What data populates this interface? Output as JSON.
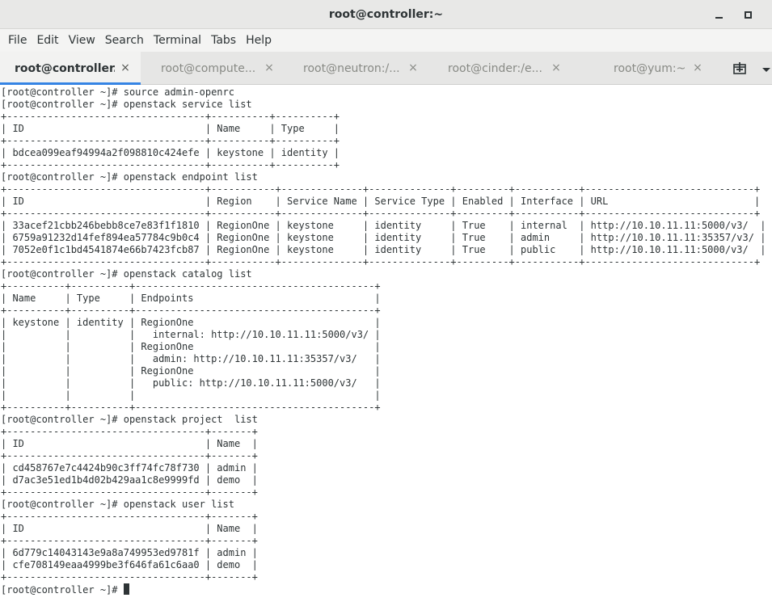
{
  "window": {
    "title": "root@controller:~"
  },
  "menu": {
    "items": [
      "File",
      "Edit",
      "View",
      "Search",
      "Terminal",
      "Tabs",
      "Help"
    ]
  },
  "tabs": [
    {
      "label": "root@controller...",
      "active": true
    },
    {
      "label": "root@compute...",
      "active": false
    },
    {
      "label": "root@neutron:/...",
      "active": false
    },
    {
      "label": "root@cinder:/e...",
      "active": false
    },
    {
      "label": "root@yum:~",
      "active": false
    }
  ],
  "tab_close_glyph": "×",
  "icons": {
    "new_tab": "new-tab-icon",
    "tab_menu": "chevron-down-icon",
    "minimize": "minimize-icon",
    "maximize": "maximize-icon",
    "close": "close-icon"
  },
  "terminal": {
    "lines": [
      "[root@controller ~]# source admin-openrc",
      "[root@controller ~]# openstack service list",
      "+----------------------------------+----------+----------+",
      "| ID                               | Name     | Type     |",
      "+----------------------------------+----------+----------+",
      "| bdcea099eaf94994a2f098810c424efe | keystone | identity |",
      "+----------------------------------+----------+----------+",
      "[root@controller ~]# openstack endpoint list",
      "+----------------------------------+-----------+--------------+--------------+---------+-----------+-----------------------------+",
      "| ID                               | Region    | Service Name | Service Type | Enabled | Interface | URL                         |",
      "+----------------------------------+-----------+--------------+--------------+---------+-----------+-----------------------------+",
      "| 33acef21cbb246bebb8ce7e83f1f1810 | RegionOne | keystone     | identity     | True    | internal  | http://10.10.11.11:5000/v3/  |",
      "| 6759a91232d14fef894ea57784c9b0c4 | RegionOne | keystone     | identity     | True    | admin     | http://10.10.11.11:35357/v3/ |",
      "| 7052e0f1c1bd4541874e66b7423fcb87 | RegionOne | keystone     | identity     | True    | public    | http://10.10.11.11:5000/v3/  |",
      "+----------------------------------+-----------+--------------+--------------+---------+-----------+-----------------------------+",
      "[root@controller ~]# openstack catalog list",
      "+----------+----------+-----------------------------------------+",
      "| Name     | Type     | Endpoints                               |",
      "+----------+----------+-----------------------------------------+",
      "| keystone | identity | RegionOne                               |",
      "|          |          |   internal: http://10.10.11.11:5000/v3/ |",
      "|          |          | RegionOne                               |",
      "|          |          |   admin: http://10.10.11.11:35357/v3/   |",
      "|          |          | RegionOne                               |",
      "|          |          |   public: http://10.10.11.11:5000/v3/   |",
      "|          |          |                                         |",
      "+----------+----------+-----------------------------------------+",
      "[root@controller ~]# openstack project  list",
      "+----------------------------------+-------+",
      "| ID                               | Name  |",
      "+----------------------------------+-------+",
      "| cd458767e7c4424b90c3ff74fc78f730 | admin |",
      "| d7ac3e51ed1b4d02b429aa1c8e9999fd | demo  |",
      "+----------------------------------+-------+",
      "[root@controller ~]# openstack user list",
      "+----------------------------------+-------+",
      "| ID                               | Name  |",
      "+----------------------------------+-------+",
      "| 6d779c14043143e9a8a749953ed9781f | admin |",
      "| cfe708149eaa4999be3f646fa61c6aa0 | demo  |",
      "+----------------------------------+-------+"
    ],
    "prompt": "[root@controller ~]# "
  }
}
